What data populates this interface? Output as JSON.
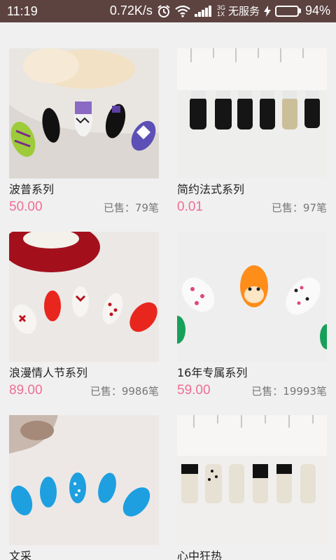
{
  "status_bar": {
    "time": "11:19",
    "speed": "0.72K/s",
    "sim_top": "3G",
    "sim_bottom": "1X",
    "carrier": "无服务",
    "battery_percent": "94%",
    "battery_level": 0.94,
    "icons": [
      "alarm-icon",
      "wifi-icon",
      "signal-icon",
      "charging-icon",
      "battery-icon"
    ]
  },
  "products": [
    {
      "name": "波普系列",
      "price": "50.00",
      "sold": "已售：79笔"
    },
    {
      "name": "简约法式系列",
      "price": "0.01",
      "sold": "已售：97笔"
    },
    {
      "name": "浪漫情人节系列",
      "price": "89.00",
      "sold": "已售：9986笔"
    },
    {
      "name": "16年专属系列",
      "price": "59.00",
      "sold": "已售：19993笔"
    },
    {
      "name": "文采",
      "price": "",
      "sold": ""
    },
    {
      "name": "心中狂热",
      "price": "",
      "sold": ""
    }
  ],
  "colors": {
    "status_bar": "#5c4340",
    "price": "#ef6e95",
    "background": "#f0f0f0"
  }
}
